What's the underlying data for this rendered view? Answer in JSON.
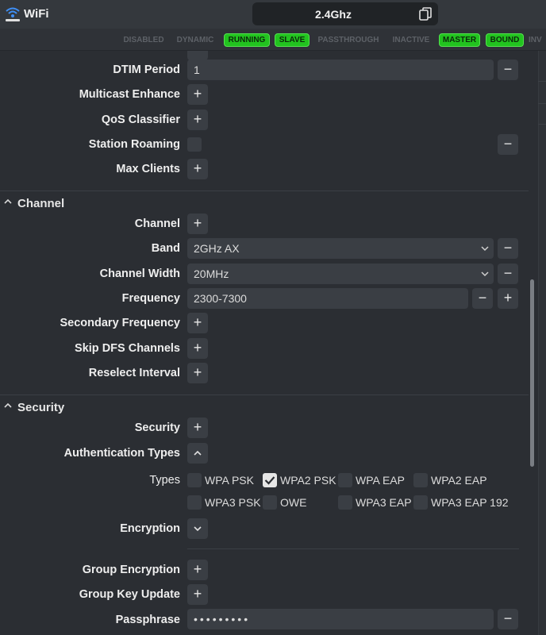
{
  "app": {
    "title": "WiFi",
    "icon": "wifi-icon",
    "interface_name": "2.4Ghz"
  },
  "status_flags": [
    {
      "label": "DISABLED",
      "active": false
    },
    {
      "label": "DYNAMIC",
      "active": false
    },
    {
      "label": "RUNNING",
      "active": true
    },
    {
      "label": "SLAVE",
      "active": true
    },
    {
      "label": "PASSTHROUGH",
      "active": false
    },
    {
      "label": "INACTIVE",
      "active": false
    },
    {
      "label": "MASTER",
      "active": true
    },
    {
      "label": "BOUND",
      "active": true
    },
    {
      "label": "INV",
      "active": false
    }
  ],
  "colors": {
    "active_flag": "#22c31f",
    "background": "#2b2e33",
    "field": "#3a3e44"
  },
  "general": {
    "dtim_period": {
      "label": "DTIM Period",
      "value": "1"
    },
    "multicast_enhance": {
      "label": "Multicast Enhance"
    },
    "qos_classifier": {
      "label": "QoS Classifier"
    },
    "station_roaming": {
      "label": "Station Roaming"
    },
    "max_clients": {
      "label": "Max Clients"
    }
  },
  "channel_section": {
    "title": "Channel",
    "channel": {
      "label": "Channel"
    },
    "band": {
      "label": "Band",
      "value": "2GHz AX"
    },
    "channel_width": {
      "label": "Channel Width",
      "value": "20MHz"
    },
    "frequency": {
      "label": "Frequency",
      "value": "2300-7300"
    },
    "secondary_frequency": {
      "label": "Secondary Frequency"
    },
    "skip_dfs": {
      "label": "Skip DFS Channels"
    },
    "reselect_interval": {
      "label": "Reselect Interval"
    }
  },
  "security_section": {
    "title": "Security",
    "security": {
      "label": "Security"
    },
    "auth_types": {
      "label": "Authentication Types"
    },
    "types_label": "Types",
    "types": [
      {
        "label": "WPA PSK",
        "checked": false
      },
      {
        "label": "WPA2 PSK",
        "checked": true
      },
      {
        "label": "WPA EAP",
        "checked": false
      },
      {
        "label": "WPA2 EAP",
        "checked": false
      },
      {
        "label": "WPA3 PSK",
        "checked": false
      },
      {
        "label": "OWE",
        "checked": false
      },
      {
        "label": "WPA3 EAP",
        "checked": false
      },
      {
        "label": "WPA3 EAP 192",
        "checked": false
      }
    ],
    "encryption": {
      "label": "Encryption"
    },
    "group_encryption": {
      "label": "Group Encryption"
    },
    "group_key_update": {
      "label": "Group Key Update"
    },
    "passphrase": {
      "label": "Passphrase",
      "value": "•••••••••"
    }
  },
  "icons": {
    "add": "+",
    "remove": "−",
    "copy": "copy-icon",
    "chevron_up": "chevron-up-icon",
    "chevron_down": "chevron-down-icon"
  }
}
